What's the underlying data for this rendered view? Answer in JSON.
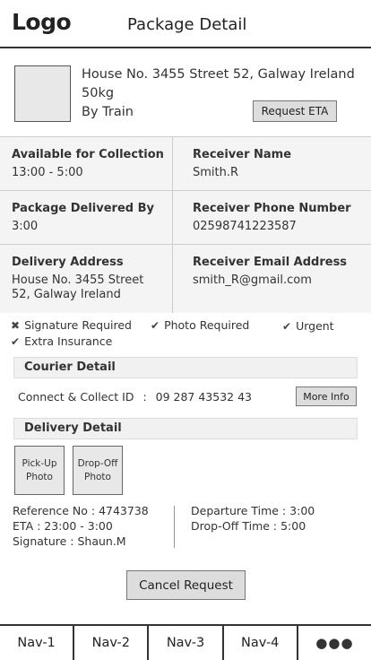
{
  "header": {
    "logo": "Logo",
    "title": "Package Detail"
  },
  "summary": {
    "address": "House No. 3455 Street 52, Galway Ireland",
    "weight": "50kg",
    "method": "By Train",
    "request_eta_label": "Request ETA"
  },
  "details": {
    "available": {
      "label": "Available for Collection",
      "value": "13:00 - 5:00"
    },
    "receiver_name": {
      "label": "Receiver Name",
      "value": "Smith.R"
    },
    "delivered_by": {
      "label": "Package Delivered By",
      "value": "3:00"
    },
    "receiver_phone": {
      "label": "Receiver Phone Number",
      "value": "02598741223587"
    },
    "delivery_address": {
      "label": "Delivery Address",
      "value": "House No. 3455 Street 52, Galway Ireland"
    },
    "receiver_email": {
      "label": "Receiver Email Address",
      "value": "smith_R@gmail.com"
    }
  },
  "tags": {
    "signature": {
      "icon": "cross-icon",
      "glyph": "✖",
      "label": "Signature Required"
    },
    "photo": {
      "icon": "check-icon",
      "glyph": "✔",
      "label": "Photo Required"
    },
    "urgent": {
      "icon": "check-icon",
      "glyph": "✔",
      "label": "Urgent"
    },
    "insurance": {
      "icon": "check-icon",
      "glyph": "✔",
      "label": "Extra Insurance"
    }
  },
  "courier": {
    "section_title": "Courier Detail",
    "collect_label": "Connect & Collect ID",
    "collect_sep": ":",
    "collect_id": "09 287 43532 43",
    "more_info_label": "More Info"
  },
  "delivery": {
    "section_title": "Delivery Detail",
    "pickup_photo": "Pick-Up Photo",
    "dropoff_photo": "Drop-Off Photo",
    "reference": "Reference No : 4743738",
    "eta": "ETA : 23:00 - 3:00",
    "signature": "Signature : Shaun.M",
    "departure": "Departure Time : 3:00",
    "dropoff_time": "Drop-Off Time : 5:00"
  },
  "actions": {
    "cancel_label": "Cancel Request"
  },
  "nav": {
    "item1": "Nav-1",
    "item2": "Nav-2",
    "item3": "Nav-3",
    "item4": "Nav-4",
    "more": "●●●"
  }
}
